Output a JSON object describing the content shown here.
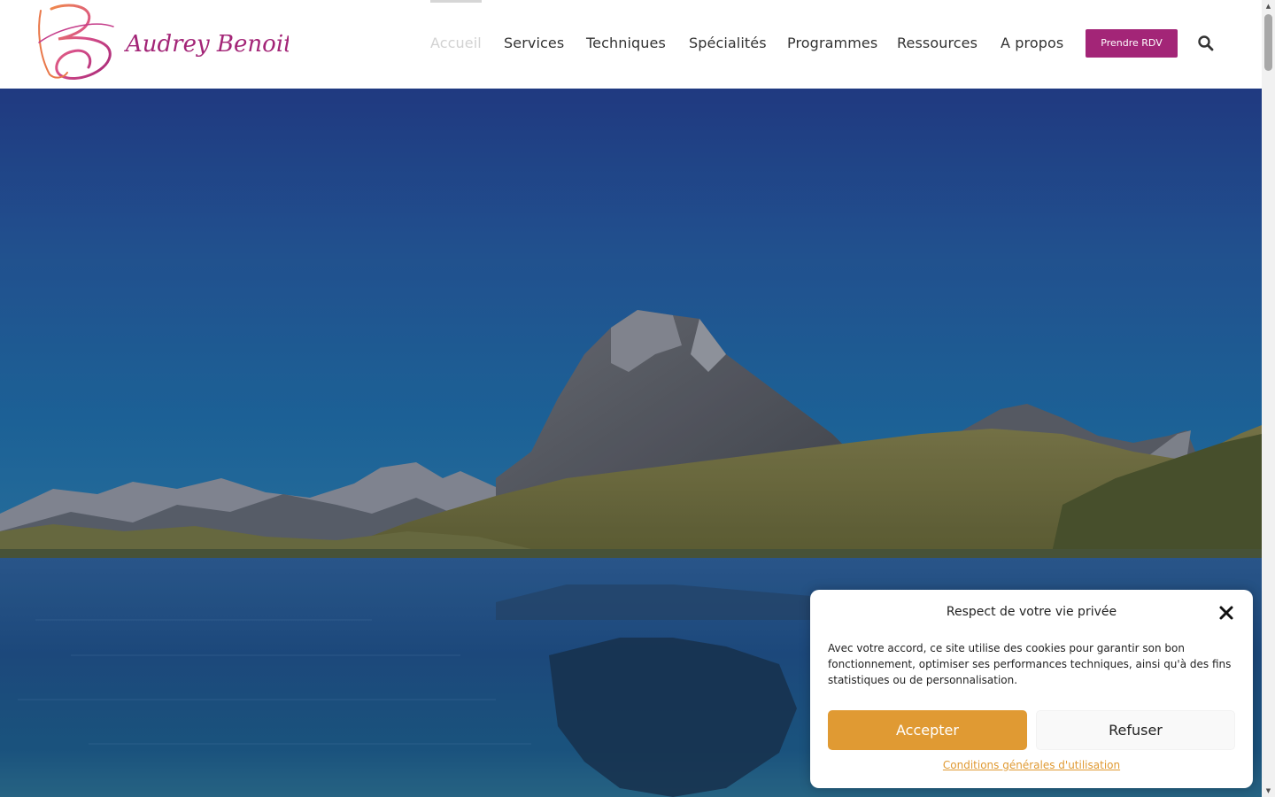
{
  "brand": {
    "logo_text": "Audrey Benoit",
    "logo_colors": [
      "#e9784a",
      "#c53d8a",
      "#a32577"
    ]
  },
  "nav": {
    "items": [
      {
        "label": "Accueil",
        "active": true
      },
      {
        "label": "Services"
      },
      {
        "label": "Techniques"
      },
      {
        "label": "Spécialités"
      },
      {
        "label": "Programmes"
      },
      {
        "label": "Ressources"
      },
      {
        "label": "A propos"
      }
    ],
    "cta_label": "Prendre RDV",
    "cta_color": "#a32577",
    "search_icon": "search-icon"
  },
  "hero": {
    "image": "mountain-lake-landscape"
  },
  "cookie": {
    "title": "Respect de votre vie privée",
    "text": "Avec votre accord, ce site utilise des cookies pour garantir son bon fonctionnement, optimiser ses performances techniques, ainsi qu'à des fins statistiques ou de personnalisation.",
    "accept_label": "Accepter",
    "refuse_label": "Refuser",
    "link_label": "Conditions générales d'utilisation",
    "accent_color": "#e09a33",
    "close_icon": "close-icon"
  }
}
